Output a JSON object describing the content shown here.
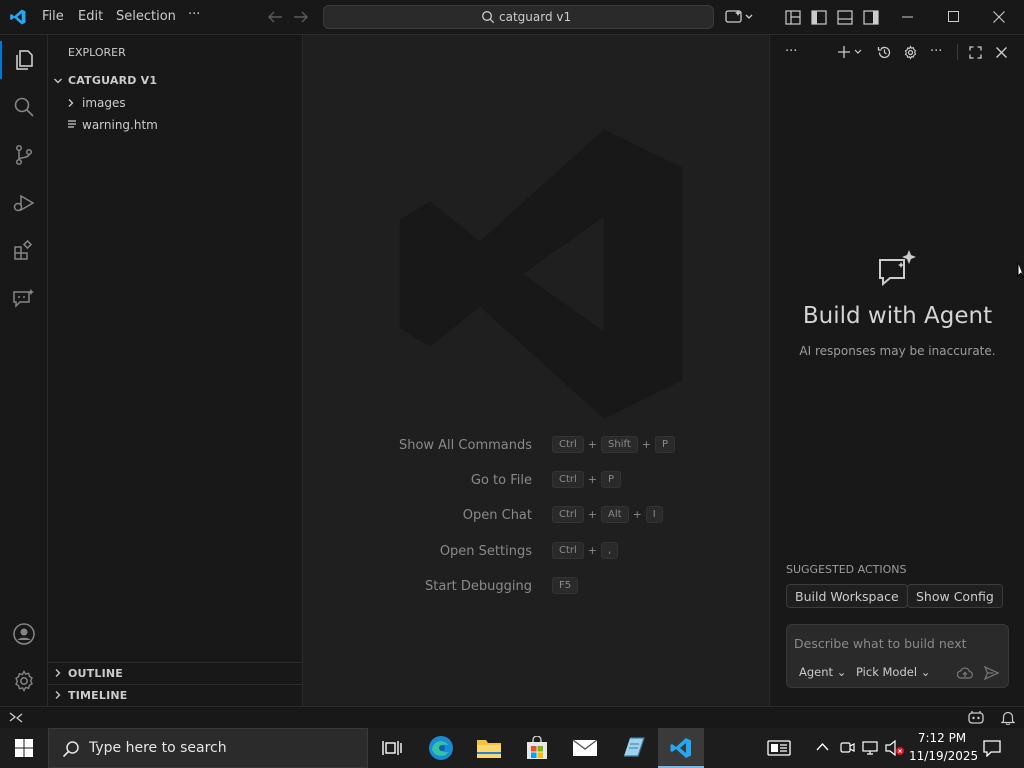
{
  "titlebar": {
    "menu": [
      "File",
      "Edit",
      "Selection"
    ],
    "more": "···",
    "search_text": "catguard v1"
  },
  "explorer": {
    "title": "EXPLORER",
    "root": "CATGUARD V1",
    "items": [
      {
        "label": "images",
        "kind": "folder"
      },
      {
        "label": "warning.htm",
        "kind": "file"
      }
    ],
    "outline": "OUTLINE",
    "timeline": "TIMELINE"
  },
  "editor": {
    "commands": [
      {
        "label": "Show All Commands",
        "keys": [
          "Ctrl",
          "Shift",
          "P"
        ]
      },
      {
        "label": "Go to File",
        "keys": [
          "Ctrl",
          "P"
        ]
      },
      {
        "label": "Open Chat",
        "keys": [
          "Ctrl",
          "Alt",
          "I"
        ]
      },
      {
        "label": "Open Settings",
        "keys": [
          "Ctrl",
          ","
        ]
      },
      {
        "label": "Start Debugging",
        "keys": [
          "F5"
        ]
      }
    ]
  },
  "chat": {
    "title": "Build with Agent",
    "subtitle": "AI responses may be inaccurate.",
    "suggested_title": "SUGGESTED ACTIONS",
    "actions": [
      "Build Workspace",
      "Show Config"
    ],
    "input_placeholder": "Describe what to build next",
    "mode": "Agent",
    "model": "Pick Model"
  },
  "taskbar": {
    "search_placeholder": "Type here to search",
    "time": "7:12 PM",
    "date": "11/19/2025"
  },
  "colors": {
    "accent": "#0078d4",
    "vscode_blue": "#23a9f2"
  }
}
